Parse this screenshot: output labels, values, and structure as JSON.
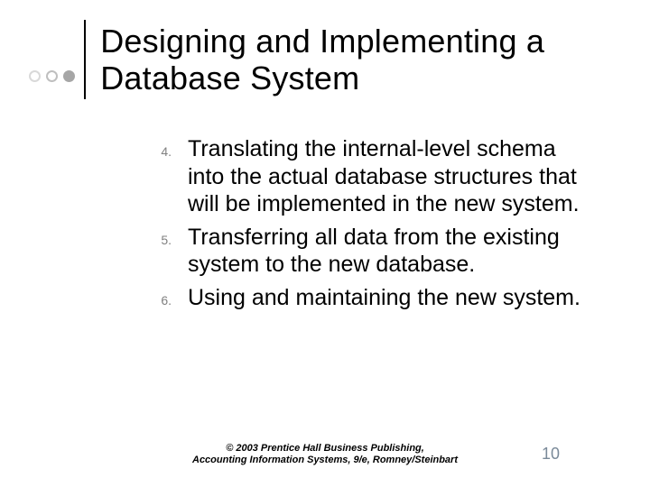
{
  "title": "Designing and Implementing a Database System",
  "list": {
    "start": 4,
    "items": [
      {
        "num": "4.",
        "text": "Translating the internal-level schema into the actual database structures that will be implemented in the new system."
      },
      {
        "num": "5.",
        "text": "Transferring all data from the existing system to the new database."
      },
      {
        "num": "6.",
        "text": "Using and maintaining the new system."
      }
    ]
  },
  "footer": {
    "line1": "© 2003 Prentice Hall Business Publishing,",
    "line2": "Accounting Information Systems, 9/e, Romney/Steinbart"
  },
  "page_number": "10"
}
